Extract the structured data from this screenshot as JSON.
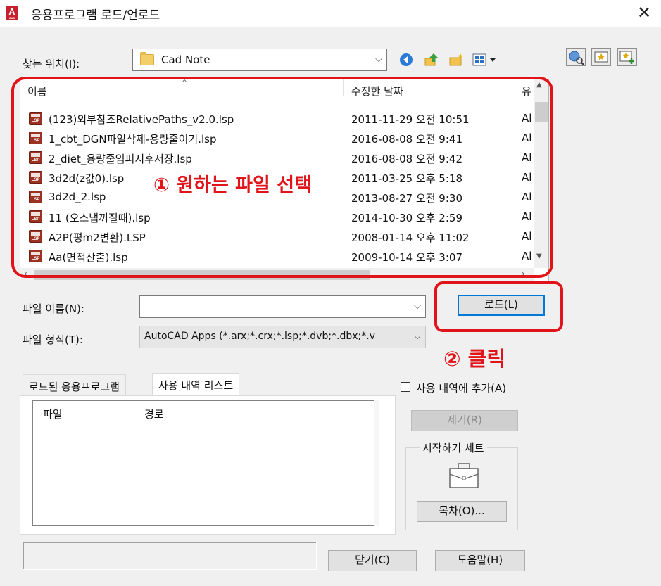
{
  "window": {
    "title": "응용프로그램 로드/언로드",
    "app_icon_letter": "A",
    "app_icon_sub": "CAD",
    "close": "✕"
  },
  "lookin": {
    "label": "찾는 위치(I):",
    "value": "Cad Note"
  },
  "list": {
    "headers": {
      "name": "이름",
      "date": "수정한 날짜",
      "type": "유"
    },
    "files": [
      {
        "name": "(123)외부참조RelativePaths_v2.0.lsp",
        "date": "2011-11-29 오전 10:51",
        "type": "Al"
      },
      {
        "name": "1_cbt_DGN파일삭제-용량줄이기.lsp",
        "date": "2016-08-08 오전 9:41",
        "type": "Al"
      },
      {
        "name": "2_diet_용량줄임퍼지후저장.lsp",
        "date": "2016-08-08 오전 9:42",
        "type": "Al"
      },
      {
        "name": "3d2d(z값0).lsp",
        "date": "2011-03-25 오후 5:18",
        "type": "Al"
      },
      {
        "name": "3d2d_2.lsp",
        "date": "2013-08-27 오전 9:30",
        "type": "Al"
      },
      {
        "name": "11  (오스냅꺼질때).lsp",
        "date": "2014-10-30 오후 2:59",
        "type": "Al"
      },
      {
        "name": "A2P(평m2변환).LSP",
        "date": "2008-01-14 오후 11:02",
        "type": "Al"
      },
      {
        "name": "Aa(면적산출).lsp",
        "date": "2009-10-14 오후 3:07",
        "type": "Al"
      }
    ]
  },
  "annotations": {
    "step1": "① 원하는 파일 선택",
    "step2": "② 클릭",
    "color": "#e1141a"
  },
  "filename": {
    "label": "파일 이름(N):",
    "value": ""
  },
  "filetype": {
    "label": "파일 형식(T):",
    "value": "AutoCAD Apps (*.arx;*.crx;*.lsp;*.dvb;*.dbx;*.v"
  },
  "buttons": {
    "load": "로드(L)",
    "remove": "제거(R)",
    "contents": "목차(O)...",
    "close": "닫기(C)",
    "help": "도움말(H)"
  },
  "tabs": [
    {
      "label": "로드된 응용프로그램"
    },
    {
      "label": "사용 내역 리스트"
    }
  ],
  "history_columns": {
    "file": "파일",
    "path": "경로"
  },
  "add_to_history": {
    "label": "사용 내역에 추가(A)",
    "checked": false
  },
  "startup_suite": {
    "label": "시작하기 세트"
  }
}
